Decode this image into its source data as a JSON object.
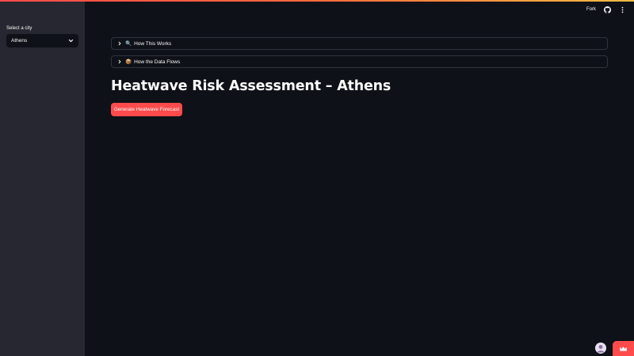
{
  "sidebar": {
    "select_label": "Select a city",
    "selected_city": "Athens"
  },
  "header": {
    "fork_label": "Fork",
    "icons": [
      "github-icon",
      "more-vertical-icon"
    ]
  },
  "expanders": [
    {
      "emoji": "🔍",
      "label": "How This Works"
    },
    {
      "emoji": "📦",
      "label": "How the Data Flows"
    }
  ],
  "main": {
    "title": "Heatwave Risk Assessment – Athens",
    "button_label": "Generate Heatwave Forecast"
  },
  "colors": {
    "accent": "#ff4b4b",
    "background": "#0e1117",
    "sidebar": "#262730"
  }
}
